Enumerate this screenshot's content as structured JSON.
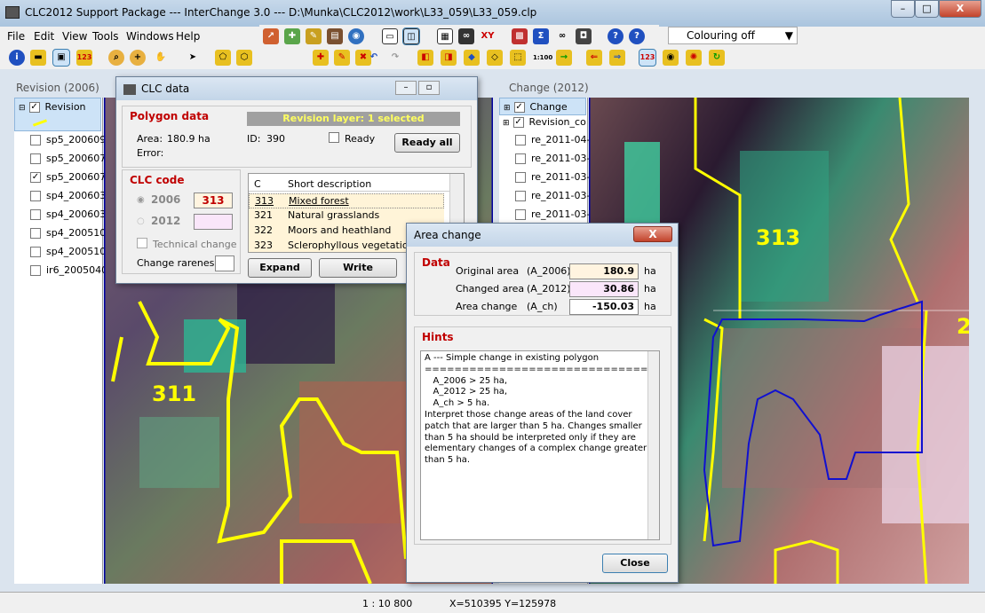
{
  "window": {
    "title": "CLC2012 Support Package --- InterChange 3.0 --- D:\\Munka\\CLC2012\\work\\L33_059\\L33_059.clp",
    "min": "–",
    "max": "□",
    "close": "X"
  },
  "menu": [
    "File",
    "Edit",
    "View",
    "Tools",
    "Windows",
    "Help"
  ],
  "colouring": {
    "value": "Colouring off"
  },
  "left_panel": {
    "header": "Revision (2006)",
    "layers": [
      {
        "label": "Revision",
        "checked": true
      },
      {
        "label": "sp5_200609",
        "checked": false
      },
      {
        "label": "sp5_200607",
        "checked": false
      },
      {
        "label": "sp5_200607",
        "checked": true
      },
      {
        "label": "sp4_200603",
        "checked": false
      },
      {
        "label": "sp4_200603",
        "checked": false
      },
      {
        "label": "sp4_200510",
        "checked": false
      },
      {
        "label": "sp4_200510",
        "checked": false
      },
      {
        "label": "ir6_2005040",
        "checked": false
      }
    ]
  },
  "right_panel": {
    "header": "Change (2012)",
    "layers": [
      {
        "label": "Change",
        "checked": true
      },
      {
        "label": "Revision_co",
        "checked": true
      },
      {
        "label": "re_2011-04-",
        "checked": false
      },
      {
        "label": "re_2011-03-",
        "checked": false
      },
      {
        "label": "re_2011-03-",
        "checked": false
      },
      {
        "label": "re_2011-03-",
        "checked": false
      },
      {
        "label": "re_2011-03-",
        "checked": false
      }
    ]
  },
  "map_labels": {
    "left_311": "311",
    "right_313": "313",
    "right_edge": "2"
  },
  "clc_dialog": {
    "title": "CLC data",
    "polygon_title": "Polygon data",
    "revision_layer": "Revision layer: 1 selected",
    "area_label": "Area:",
    "area_value": "180.9 ha",
    "id_label": "ID:",
    "id_value": "390",
    "error_label": "Error:",
    "ready_label": "Ready",
    "ready_all": "Ready all",
    "clc_code_title": "CLC code",
    "year_2006": "2006",
    "code_2006": "313",
    "year_2012": "2012",
    "technical_change": "Technical change",
    "change_rareness": "Change rareness",
    "table_headers": [
      "C",
      "Short description"
    ],
    "table_rows": [
      {
        "code": "313",
        "desc": "Mixed forest"
      },
      {
        "code": "321",
        "desc": "Natural grasslands"
      },
      {
        "code": "322",
        "desc": "Moors and heathland"
      },
      {
        "code": "323",
        "desc": "Sclerophyllous vegetation"
      }
    ],
    "expand": "Expand",
    "write": "Write"
  },
  "area_dialog": {
    "title": "Area change",
    "data_title": "Data",
    "rows": [
      {
        "label": "Original area",
        "code": "(A_2006)",
        "value": "180.9",
        "unit": "ha"
      },
      {
        "label": "Changed area",
        "code": "(A_2012)",
        "value": "30.86",
        "unit": "ha"
      },
      {
        "label": "Area change",
        "code": "(A_ch)",
        "value": "-150.03",
        "unit": "ha"
      }
    ],
    "hints_title": "Hints",
    "hints": [
      "A --- Simple change in existing polygon",
      "================================",
      "   A_2006 > 25 ha,",
      "   A_2012 > 25 ha,",
      "   A_ch > 5 ha.",
      "Interpret those change areas of the land cover",
      "patch that are larger than 5 ha. Changes smaller",
      "than 5 ha should be interpreted only if they are",
      "elementary changes of a complex change greater",
      "than 5 ha."
    ],
    "close": "Close"
  },
  "status": {
    "scale": "1 : 10 800",
    "coords": "X=510395  Y=125978"
  }
}
